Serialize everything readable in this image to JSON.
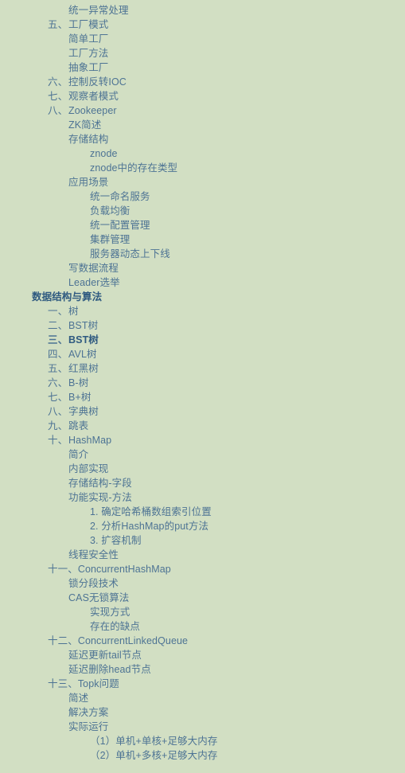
{
  "panel": {
    "name": "table-of-contents",
    "background_color": "#d2dfc3",
    "link_color": "#4d7394",
    "heading_color": "#2f5a80",
    "active_color": "#2f5a80"
  },
  "items": [
    {
      "num": "",
      "label": "统一异常处理",
      "level": 2,
      "kind": "link",
      "active": false
    },
    {
      "num": "五、",
      "label": "工厂模式",
      "level": 1,
      "kind": "link",
      "active": false
    },
    {
      "num": "",
      "label": "简单工厂",
      "level": 2,
      "kind": "link",
      "active": false
    },
    {
      "num": "",
      "label": "工厂方法",
      "level": 2,
      "kind": "link",
      "active": false
    },
    {
      "num": "",
      "label": "抽象工厂",
      "level": 2,
      "kind": "link",
      "active": false
    },
    {
      "num": "六、",
      "label": "控制反转IOC",
      "level": 1,
      "kind": "link",
      "active": false
    },
    {
      "num": "七、",
      "label": "观察者模式",
      "level": 1,
      "kind": "link",
      "active": false
    },
    {
      "num": "八、",
      "label": "Zookeeper",
      "level": 1,
      "kind": "link",
      "active": false
    },
    {
      "num": "",
      "label": "ZK简述",
      "level": 2,
      "kind": "link",
      "active": false
    },
    {
      "num": "",
      "label": "存储结构",
      "level": 2,
      "kind": "link",
      "active": false
    },
    {
      "num": "",
      "label": "znode",
      "level": 3,
      "kind": "link",
      "active": false
    },
    {
      "num": "",
      "label": "znode中的存在类型",
      "level": 3,
      "kind": "link",
      "active": false
    },
    {
      "num": "",
      "label": "应用场景",
      "level": 2,
      "kind": "link",
      "active": false
    },
    {
      "num": "",
      "label": "统一命名服务",
      "level": 3,
      "kind": "link",
      "active": false
    },
    {
      "num": "",
      "label": "负载均衡",
      "level": 3,
      "kind": "link",
      "active": false
    },
    {
      "num": "",
      "label": "统一配置管理",
      "level": 3,
      "kind": "link",
      "active": false
    },
    {
      "num": "",
      "label": "集群管理",
      "level": 3,
      "kind": "link",
      "active": false
    },
    {
      "num": "",
      "label": "服务器动态上下线",
      "level": 3,
      "kind": "link",
      "active": false
    },
    {
      "num": "",
      "label": "写数据流程",
      "level": 2,
      "kind": "link",
      "active": false
    },
    {
      "num": "",
      "label": "Leader选举",
      "level": 2,
      "kind": "link",
      "active": false
    },
    {
      "num": "",
      "label": "数据结构与算法",
      "level": 0,
      "kind": "heading",
      "active": false
    },
    {
      "num": "一、",
      "label": "树",
      "level": 1,
      "kind": "link",
      "active": false
    },
    {
      "num": "二、",
      "label": "BST树",
      "level": 1,
      "kind": "link",
      "active": false
    },
    {
      "num": "三、",
      "label": "BST树",
      "level": 1,
      "kind": "link",
      "active": true
    },
    {
      "num": "四、",
      "label": "AVL树",
      "level": 1,
      "kind": "link",
      "active": false
    },
    {
      "num": "五、",
      "label": "红黑树",
      "level": 1,
      "kind": "link",
      "active": false
    },
    {
      "num": "六、",
      "label": "B-树",
      "level": 1,
      "kind": "link",
      "active": false
    },
    {
      "num": "七、",
      "label": "B+树",
      "level": 1,
      "kind": "link",
      "active": false
    },
    {
      "num": "八、",
      "label": "字典树",
      "level": 1,
      "kind": "link",
      "active": false
    },
    {
      "num": "九、",
      "label": "跳表",
      "level": 1,
      "kind": "link",
      "active": false
    },
    {
      "num": "十、",
      "label": "HashMap",
      "level": 1,
      "kind": "link",
      "active": false
    },
    {
      "num": "",
      "label": "简介",
      "level": 2,
      "kind": "link",
      "active": false
    },
    {
      "num": "",
      "label": "内部实现",
      "level": 2,
      "kind": "link",
      "active": false
    },
    {
      "num": "",
      "label": "存储结构-字段",
      "level": 2,
      "kind": "link",
      "active": false
    },
    {
      "num": "",
      "label": "功能实现-方法",
      "level": 2,
      "kind": "link",
      "active": false
    },
    {
      "num": "",
      "label": "1. 确定哈希桶数组索引位置",
      "level": 3,
      "kind": "link",
      "active": false
    },
    {
      "num": "",
      "label": "2. 分析HashMap的put方法",
      "level": 3,
      "kind": "link",
      "active": false
    },
    {
      "num": "",
      "label": "3. 扩容机制",
      "level": 3,
      "kind": "link",
      "active": false
    },
    {
      "num": "",
      "label": "线程安全性",
      "level": 2,
      "kind": "link",
      "active": false
    },
    {
      "num": "十一、",
      "label": "ConcurrentHashMap",
      "level": 1,
      "kind": "link",
      "active": false
    },
    {
      "num": "",
      "label": "锁分段技术",
      "level": 2,
      "kind": "link",
      "active": false
    },
    {
      "num": "",
      "label": "CAS无锁算法",
      "level": 2,
      "kind": "link",
      "active": false
    },
    {
      "num": "",
      "label": "实现方式",
      "level": 3,
      "kind": "link",
      "active": false
    },
    {
      "num": "",
      "label": "存在的缺点",
      "level": 3,
      "kind": "link",
      "active": false
    },
    {
      "num": "十二、",
      "label": "ConcurrentLinkedQueue",
      "level": 1,
      "kind": "link",
      "active": false
    },
    {
      "num": "",
      "label": "延迟更新tail节点",
      "level": 2,
      "kind": "link",
      "active": false
    },
    {
      "num": "",
      "label": "延迟删除head节点",
      "level": 2,
      "kind": "link",
      "active": false
    },
    {
      "num": "十三、",
      "label": "Topk问题",
      "level": 1,
      "kind": "link",
      "active": false
    },
    {
      "num": "",
      "label": "简述",
      "level": 2,
      "kind": "link",
      "active": false
    },
    {
      "num": "",
      "label": "解决方案",
      "level": 2,
      "kind": "link",
      "active": false
    },
    {
      "num": "",
      "label": "实际运行",
      "level": 2,
      "kind": "link",
      "active": false
    },
    {
      "num": "",
      "label": "（1）单机+单核+足够大内存",
      "level": 3,
      "kind": "link",
      "active": false
    },
    {
      "num": "",
      "label": "（2）单机+多核+足够大内存",
      "level": 3,
      "kind": "link",
      "active": false
    }
  ]
}
